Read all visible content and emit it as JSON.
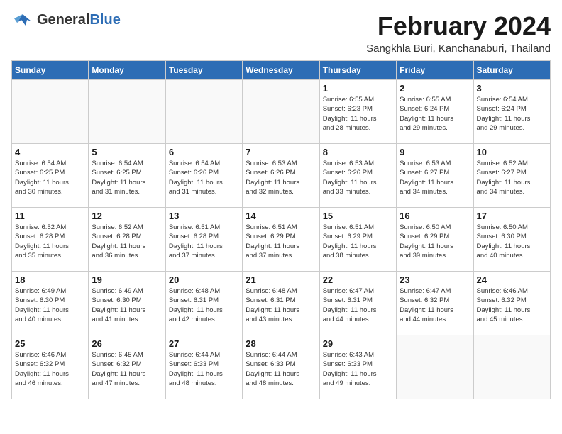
{
  "header": {
    "logo": {
      "general": "General",
      "blue": "Blue"
    },
    "month": "February 2024",
    "location": "Sangkhla Buri, Kanchanaburi, Thailand"
  },
  "weekdays": [
    "Sunday",
    "Monday",
    "Tuesday",
    "Wednesday",
    "Thursday",
    "Friday",
    "Saturday"
  ],
  "weeks": [
    [
      {
        "day": "",
        "info": ""
      },
      {
        "day": "",
        "info": ""
      },
      {
        "day": "",
        "info": ""
      },
      {
        "day": "",
        "info": ""
      },
      {
        "day": "1",
        "info": "Sunrise: 6:55 AM\nSunset: 6:23 PM\nDaylight: 11 hours\nand 28 minutes."
      },
      {
        "day": "2",
        "info": "Sunrise: 6:55 AM\nSunset: 6:24 PM\nDaylight: 11 hours\nand 29 minutes."
      },
      {
        "day": "3",
        "info": "Sunrise: 6:54 AM\nSunset: 6:24 PM\nDaylight: 11 hours\nand 29 minutes."
      }
    ],
    [
      {
        "day": "4",
        "info": "Sunrise: 6:54 AM\nSunset: 6:25 PM\nDaylight: 11 hours\nand 30 minutes."
      },
      {
        "day": "5",
        "info": "Sunrise: 6:54 AM\nSunset: 6:25 PM\nDaylight: 11 hours\nand 31 minutes."
      },
      {
        "day": "6",
        "info": "Sunrise: 6:54 AM\nSunset: 6:26 PM\nDaylight: 11 hours\nand 31 minutes."
      },
      {
        "day": "7",
        "info": "Sunrise: 6:53 AM\nSunset: 6:26 PM\nDaylight: 11 hours\nand 32 minutes."
      },
      {
        "day": "8",
        "info": "Sunrise: 6:53 AM\nSunset: 6:26 PM\nDaylight: 11 hours\nand 33 minutes."
      },
      {
        "day": "9",
        "info": "Sunrise: 6:53 AM\nSunset: 6:27 PM\nDaylight: 11 hours\nand 34 minutes."
      },
      {
        "day": "10",
        "info": "Sunrise: 6:52 AM\nSunset: 6:27 PM\nDaylight: 11 hours\nand 34 minutes."
      }
    ],
    [
      {
        "day": "11",
        "info": "Sunrise: 6:52 AM\nSunset: 6:28 PM\nDaylight: 11 hours\nand 35 minutes."
      },
      {
        "day": "12",
        "info": "Sunrise: 6:52 AM\nSunset: 6:28 PM\nDaylight: 11 hours\nand 36 minutes."
      },
      {
        "day": "13",
        "info": "Sunrise: 6:51 AM\nSunset: 6:28 PM\nDaylight: 11 hours\nand 37 minutes."
      },
      {
        "day": "14",
        "info": "Sunrise: 6:51 AM\nSunset: 6:29 PM\nDaylight: 11 hours\nand 37 minutes."
      },
      {
        "day": "15",
        "info": "Sunrise: 6:51 AM\nSunset: 6:29 PM\nDaylight: 11 hours\nand 38 minutes."
      },
      {
        "day": "16",
        "info": "Sunrise: 6:50 AM\nSunset: 6:29 PM\nDaylight: 11 hours\nand 39 minutes."
      },
      {
        "day": "17",
        "info": "Sunrise: 6:50 AM\nSunset: 6:30 PM\nDaylight: 11 hours\nand 40 minutes."
      }
    ],
    [
      {
        "day": "18",
        "info": "Sunrise: 6:49 AM\nSunset: 6:30 PM\nDaylight: 11 hours\nand 40 minutes."
      },
      {
        "day": "19",
        "info": "Sunrise: 6:49 AM\nSunset: 6:30 PM\nDaylight: 11 hours\nand 41 minutes."
      },
      {
        "day": "20",
        "info": "Sunrise: 6:48 AM\nSunset: 6:31 PM\nDaylight: 11 hours\nand 42 minutes."
      },
      {
        "day": "21",
        "info": "Sunrise: 6:48 AM\nSunset: 6:31 PM\nDaylight: 11 hours\nand 43 minutes."
      },
      {
        "day": "22",
        "info": "Sunrise: 6:47 AM\nSunset: 6:31 PM\nDaylight: 11 hours\nand 44 minutes."
      },
      {
        "day": "23",
        "info": "Sunrise: 6:47 AM\nSunset: 6:32 PM\nDaylight: 11 hours\nand 44 minutes."
      },
      {
        "day": "24",
        "info": "Sunrise: 6:46 AM\nSunset: 6:32 PM\nDaylight: 11 hours\nand 45 minutes."
      }
    ],
    [
      {
        "day": "25",
        "info": "Sunrise: 6:46 AM\nSunset: 6:32 PM\nDaylight: 11 hours\nand 46 minutes."
      },
      {
        "day": "26",
        "info": "Sunrise: 6:45 AM\nSunset: 6:32 PM\nDaylight: 11 hours\nand 47 minutes."
      },
      {
        "day": "27",
        "info": "Sunrise: 6:44 AM\nSunset: 6:33 PM\nDaylight: 11 hours\nand 48 minutes."
      },
      {
        "day": "28",
        "info": "Sunrise: 6:44 AM\nSunset: 6:33 PM\nDaylight: 11 hours\nand 48 minutes."
      },
      {
        "day": "29",
        "info": "Sunrise: 6:43 AM\nSunset: 6:33 PM\nDaylight: 11 hours\nand 49 minutes."
      },
      {
        "day": "",
        "info": ""
      },
      {
        "day": "",
        "info": ""
      }
    ]
  ]
}
